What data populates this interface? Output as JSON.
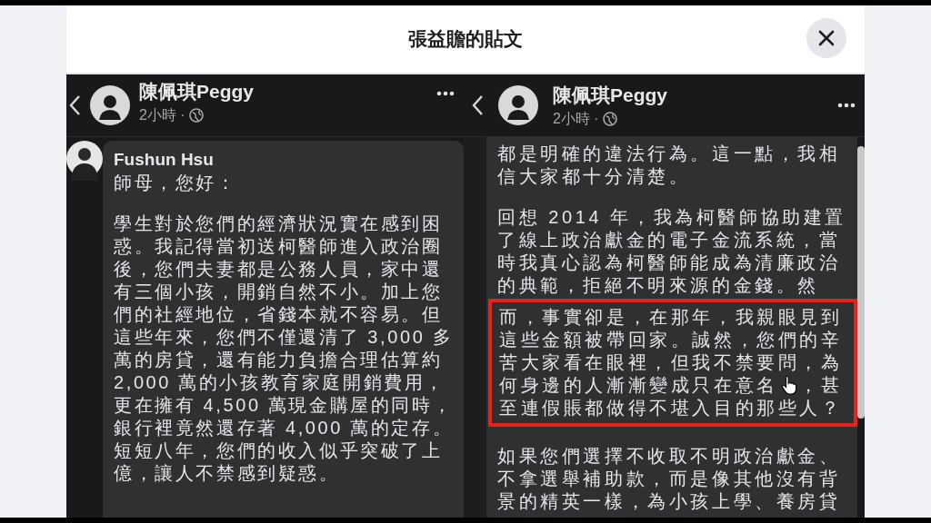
{
  "dialog": {
    "title": "張益贍的貼文"
  },
  "panels": [
    {
      "author": "陳佩琪Peggy",
      "time": "2小時 ·",
      "comment_author": "Fushun Hsu",
      "paragraphs": [
        {
          "segments": [
            {
              "lines": [
                "師母，您好："
              ],
              "highlighted": false
            }
          ]
        },
        {
          "segments": [
            {
              "lines": [
                "學生對於您們的經濟狀況實在感到困",
                "惑。我記得當初送柯醫師進入政治圈",
                "後，您們夫妻都是公務人員，家中還",
                "有三個小孩，開銷自然不小。加上您",
                "們的社經地位，省錢本就不容易。但",
                "這些年來，您們不僅還清了 3,000 多",
                "萬的房貸，還有能力負擔合理估算約",
                "2,000 萬的小孩教育家庭開銷費用，",
                "更在擁有 4,500 萬現金購屋的同時，",
                "銀行裡竟然還存著 4,000 萬的定存。",
                "短短八年，您們的收入似乎突破了上",
                "億，讓人不禁感到疑惑。"
              ],
              "highlighted": false
            }
          ]
        }
      ]
    },
    {
      "author": "陳佩琪Peggy",
      "time": "2小時 ·",
      "paragraphs": [
        {
          "segments": [
            {
              "lines": [
                "都是明確的違法行為。這一點，我相",
                "信大家都十分清楚。"
              ],
              "highlighted": false
            }
          ]
        },
        {
          "segments": [
            {
              "lines": [
                "回想 2014 年，我為柯醫師協助建置",
                "了線上政治獻金的電子金流系統，當",
                "時我真心認為柯醫師能成為清廉政治",
                "的典範，拒絕不明來源的金錢。然"
              ],
              "highlighted": false
            },
            {
              "lines": [
                "而，事實卻是，在那年，我親眼見到",
                "這些金額被帶回家。誠然，您們的辛",
                "苦大家看在眼裡，但我不禁要問，為",
                "何身邊的人漸漸變成只在意名　，甚",
                "至連假賬都做得不堪入目的那些人？"
              ],
              "highlighted": true
            }
          ]
        },
        {
          "segments": [
            {
              "lines": [
                "如果您們選擇不收取不明政治獻金、",
                "不拿選舉補助款，而是像其他沒有背",
                "景的精英一樣，為小孩上學、養房貸"
              ],
              "highlighted": false
            }
          ]
        }
      ]
    }
  ]
}
